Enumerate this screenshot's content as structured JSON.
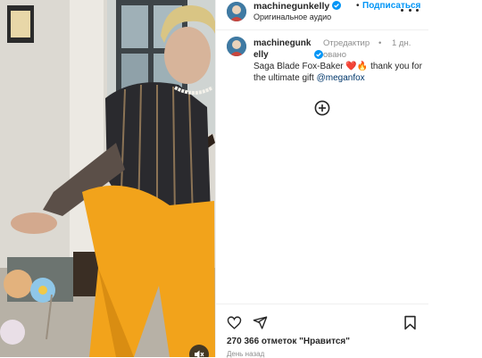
{
  "header": {
    "username": "machinegunkelly",
    "dot": "•",
    "follow_label": "Подписаться",
    "audio_label": "Оригинальное аудио"
  },
  "caption": {
    "username": "machinegunkelly",
    "edited_label": "Отредактировано",
    "bullet": "•",
    "time": "1 дн.",
    "text_before": "Saga Blade Fox-Baker",
    "emoji": "❤️🔥",
    "text_after": " thank you for the ultimate gift ",
    "mention": "@meganfox"
  },
  "footer": {
    "likes": "270 366 отметок \"Нравится\"",
    "date": "День назад"
  },
  "icons": [
    "verified-badge-icon",
    "more-icon",
    "plus-circle-icon",
    "heart-icon",
    "share-icon",
    "bookmark-icon",
    "mute-icon"
  ],
  "colors": {
    "accent": "#0095f6",
    "mention": "#00376b",
    "muted_text": "#8e8e8e",
    "pants_yellow": "#f2a31b"
  }
}
